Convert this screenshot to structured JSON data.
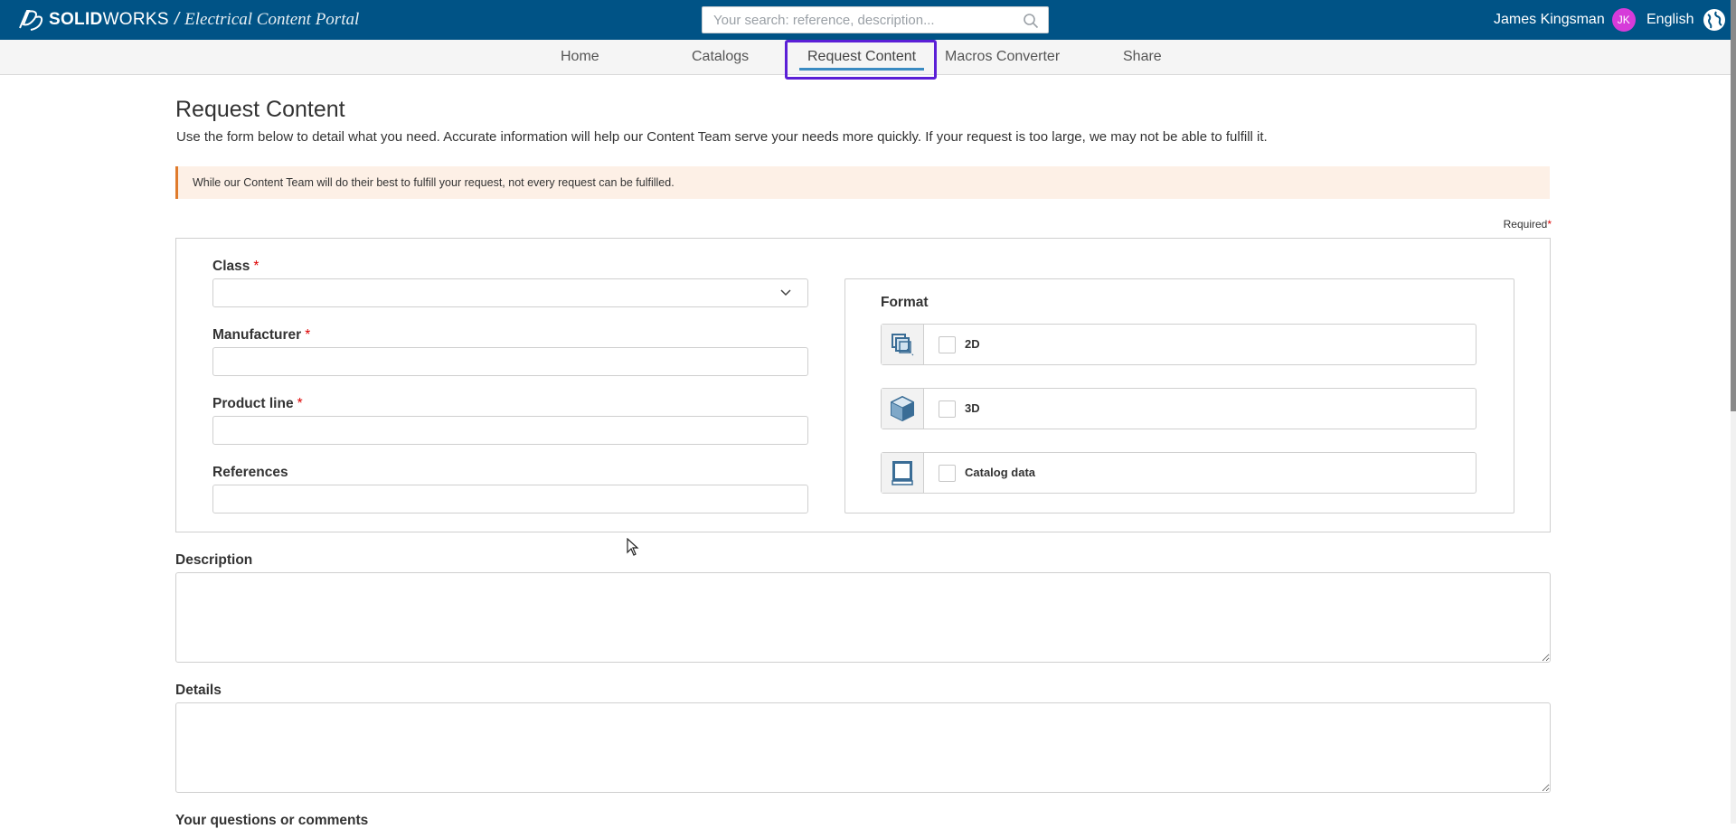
{
  "app": {
    "brand_bold": "SOLID",
    "brand_thin": "WORKS",
    "separator": "/",
    "portal_name": "Electrical Content Portal"
  },
  "search": {
    "placeholder": "Your search: reference, description..."
  },
  "user": {
    "name": "James Kingsman",
    "initials": "JK"
  },
  "language": {
    "label": "English"
  },
  "nav": {
    "tabs": [
      {
        "label": "Home"
      },
      {
        "label": "Catalogs"
      },
      {
        "label": "Request Content",
        "active": true
      },
      {
        "label": "Macros Converter"
      },
      {
        "label": "Share"
      }
    ]
  },
  "page": {
    "title": "Request Content",
    "intro": "Use the form below to detail what you need. Accurate information will help our Content Team serve your needs more quickly. If your request is too large, we may not be able to fulfill it.",
    "notice": "While our Content Team will do their best to fulfill your request, not every request can be fulfilled.",
    "required_label": "Required",
    "required_star": "*"
  },
  "form": {
    "class_label": "Class",
    "class_value": "",
    "manufacturer_label": "Manufacturer",
    "manufacturer_value": "",
    "product_line_label": "Product line",
    "product_line_value": "",
    "references_label": "References",
    "references_value": "",
    "format_title": "Format",
    "formats": [
      {
        "label": "2D",
        "checked": false,
        "icon": "2d-layers-icon"
      },
      {
        "label": "3D",
        "checked": false,
        "icon": "3d-cube-icon"
      },
      {
        "label": "Catalog data",
        "checked": false,
        "icon": "catalog-book-icon"
      }
    ],
    "description_label": "Description",
    "details_label": "Details",
    "questions_label": "Your questions or comments"
  },
  "colors": {
    "topbar": "#005386",
    "focus_ring": "#5b1fd6",
    "tab_underline": "#3a8bc2",
    "notice_bg": "#fdf0e6",
    "notice_border": "#e07b2c",
    "required": "#dd0000",
    "avatar": "#d63bd9"
  }
}
